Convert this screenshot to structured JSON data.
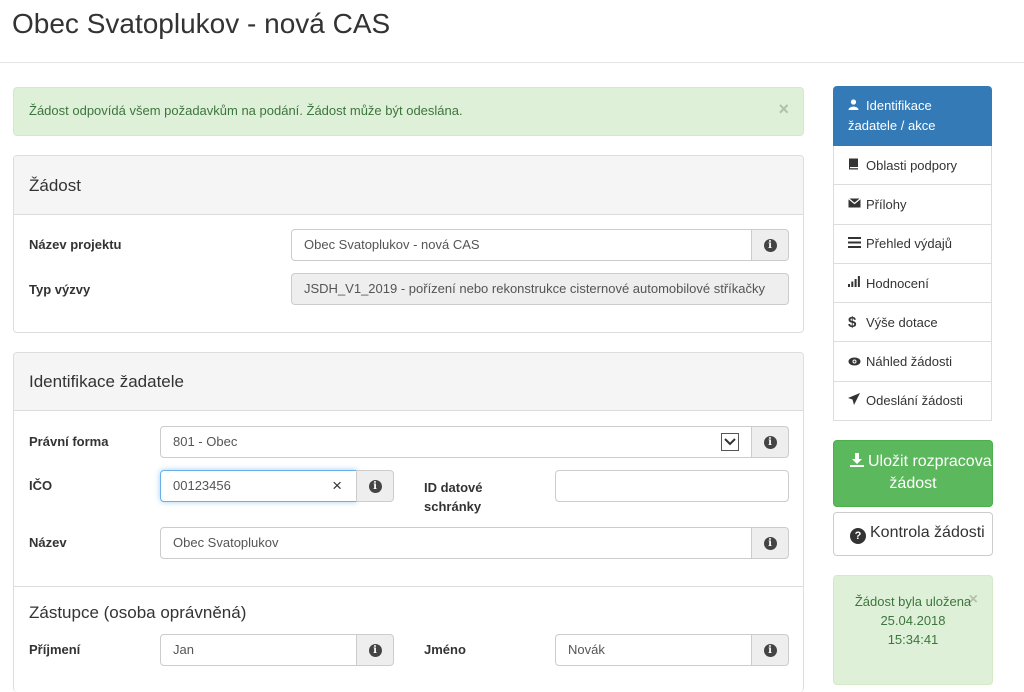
{
  "page": {
    "title": "Obec Svatoplukov - nová CAS"
  },
  "alert": {
    "text": "Žádost odpovídá všem požadavkům na podání. Žádost může být odeslána.",
    "close": "×"
  },
  "zadost": {
    "heading": "Žádost",
    "nazev_label": "Název projektu",
    "nazev_value": "Obec Svatoplukov - nová CAS",
    "typ_label": "Typ výzvy",
    "typ_value": "JSDH_V1_2019 - pořízení nebo rekonstrukce cisternové automobilové stříkačky"
  },
  "identifikace": {
    "heading": "Identifikace žadatele",
    "pravni_label": "Právní forma",
    "pravni_value": "801 - Obec",
    "ico_label": "IČO",
    "ico_value": "00123456",
    "datova_label": "ID datové schránky",
    "datova_value": "",
    "nazev_label": "Název",
    "nazev_value": "Obec Svatoplukov"
  },
  "zastupce": {
    "heading": "Zástupce (osoba oprávněná)",
    "prijmeni_label": "Příjmení",
    "prijmeni_value": "Jan",
    "jmeno_label": "Jméno",
    "jmeno_value": "Novák"
  },
  "nav": {
    "items": [
      {
        "label": "Identifikace žadatele / akce",
        "icon": "user-icon"
      },
      {
        "label": "Oblasti podpory",
        "icon": "book-icon"
      },
      {
        "label": "Přílohy",
        "icon": "envelope-icon"
      },
      {
        "label": "Přehled výdajů",
        "icon": "list-icon"
      },
      {
        "label": "Hodnocení",
        "icon": "signal-icon"
      },
      {
        "label": "Výše dotace",
        "icon": "dollar-icon"
      },
      {
        "label": "Náhled žádosti",
        "icon": "eye-icon"
      },
      {
        "label": "Odeslání žádosti",
        "icon": "send-icon"
      }
    ]
  },
  "actions": {
    "save_line1": "Uložit rozpracovanou",
    "save_line2": "žádost",
    "check": "Kontrola žádosti"
  },
  "saved": {
    "line1": "Žádost byla uložena",
    "date": "25.04.2018",
    "time": "15:34:41",
    "close": "×"
  },
  "colors": {
    "primary": "#337ab7",
    "success": "#5cb85c",
    "success_bg": "#dff0d8"
  }
}
